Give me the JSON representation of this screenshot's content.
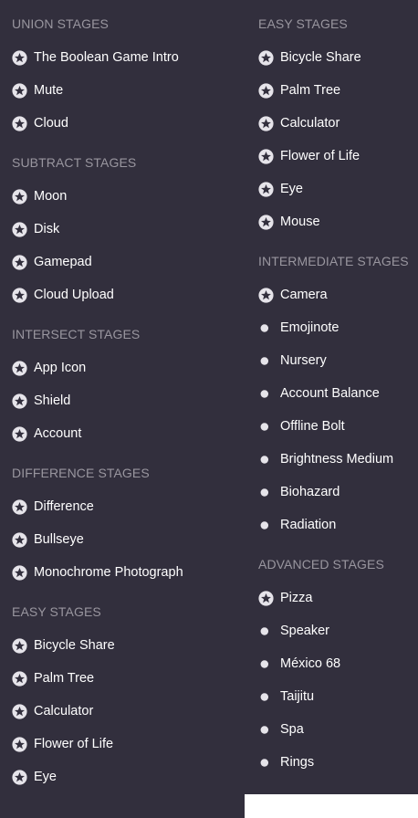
{
  "left_column": {
    "sections": [
      {
        "heading": "UNION STAGES",
        "items": [
          {
            "label": "The Boolean Game Intro",
            "icon": "star-badge-icon"
          },
          {
            "label": "Mute",
            "icon": "star-badge-icon"
          },
          {
            "label": "Cloud",
            "icon": "star-badge-icon"
          }
        ]
      },
      {
        "heading": "SUBTRACT STAGES",
        "items": [
          {
            "label": "Moon",
            "icon": "star-badge-icon"
          },
          {
            "label": "Disk",
            "icon": "star-badge-icon"
          },
          {
            "label": "Gamepad",
            "icon": "star-badge-icon"
          },
          {
            "label": "Cloud Upload",
            "icon": "star-badge-icon"
          }
        ]
      },
      {
        "heading": "INTERSECT STAGES",
        "items": [
          {
            "label": "App Icon",
            "icon": "star-badge-icon"
          },
          {
            "label": "Shield",
            "icon": "star-badge-icon"
          },
          {
            "label": "Account",
            "icon": "star-badge-icon"
          }
        ]
      },
      {
        "heading": "DIFFERENCE STAGES",
        "items": [
          {
            "label": "Difference",
            "icon": "star-badge-icon"
          },
          {
            "label": "Bullseye",
            "icon": "star-badge-icon"
          },
          {
            "label": "Monochrome Photograph",
            "icon": "star-badge-icon"
          }
        ]
      },
      {
        "heading": "EASY STAGES",
        "items": [
          {
            "label": "Bicycle Share",
            "icon": "star-badge-icon"
          },
          {
            "label": "Palm Tree",
            "icon": "star-badge-icon"
          },
          {
            "label": "Calculator",
            "icon": "star-badge-icon"
          },
          {
            "label": "Flower of Life",
            "icon": "star-badge-icon"
          },
          {
            "label": "Eye",
            "icon": "star-badge-icon"
          }
        ]
      }
    ]
  },
  "right_column": {
    "sections": [
      {
        "heading": "EASY STAGES",
        "items": [
          {
            "label": "Bicycle Share",
            "icon": "star-badge-icon"
          },
          {
            "label": "Palm Tree",
            "icon": "star-badge-icon"
          },
          {
            "label": "Calculator",
            "icon": "star-badge-icon"
          },
          {
            "label": "Flower of Life",
            "icon": "star-badge-icon"
          },
          {
            "label": "Eye",
            "icon": "star-badge-icon"
          },
          {
            "label": "Mouse",
            "icon": "star-badge-icon"
          }
        ]
      },
      {
        "heading": "INTERMEDIATE STAGES",
        "items": [
          {
            "label": "Camera",
            "icon": "star-badge-icon"
          },
          {
            "label": "Emojinote",
            "icon": "dot-icon"
          },
          {
            "label": "Nursery",
            "icon": "dot-icon"
          },
          {
            "label": "Account Balance",
            "icon": "dot-icon"
          },
          {
            "label": "Offline Bolt",
            "icon": "dot-icon"
          },
          {
            "label": "Brightness Medium",
            "icon": "dot-icon"
          },
          {
            "label": "Biohazard",
            "icon": "dot-icon"
          },
          {
            "label": "Radiation",
            "icon": "dot-icon"
          }
        ]
      },
      {
        "heading": "ADVANCED STAGES",
        "items": [
          {
            "label": "Pizza",
            "icon": "star-badge-icon"
          },
          {
            "label": "Speaker",
            "icon": "dot-icon"
          },
          {
            "label": "México 68",
            "icon": "dot-icon"
          },
          {
            "label": "Taijitu",
            "icon": "dot-icon"
          },
          {
            "label": "Spa",
            "icon": "dot-icon"
          },
          {
            "label": "Rings",
            "icon": "dot-icon"
          }
        ]
      }
    ]
  },
  "colors": {
    "panel_background": "#322f3d",
    "heading_text": "#99969f",
    "item_text": "#ffffff",
    "icon_fill": "#e6e4ea",
    "icon_star": "#322f3d",
    "page_background": "#ffffff"
  }
}
